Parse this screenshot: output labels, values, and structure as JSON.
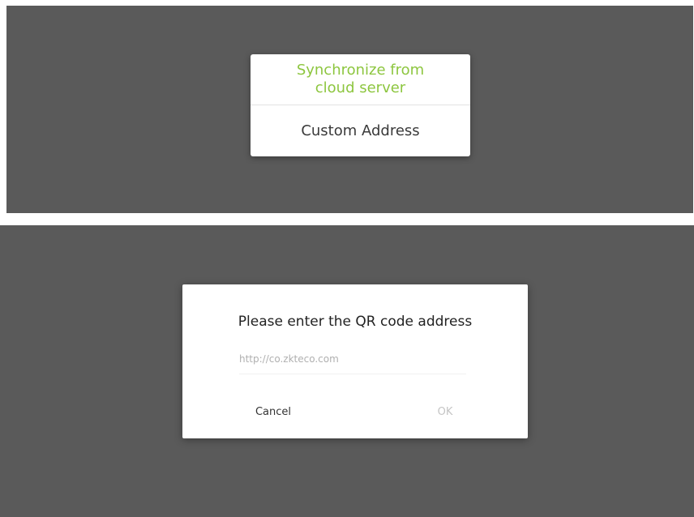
{
  "sync_menu": {
    "options": [
      {
        "label": "Synchronize from\ncloud server",
        "color": "#8dc63f"
      },
      {
        "label": "Custom Address",
        "color": "#3a3a3a"
      }
    ]
  },
  "qr_dialog": {
    "title": "Please enter the QR code address",
    "address_value": "http://co.zkteco.com",
    "cancel_label": "Cancel",
    "ok_label": "OK"
  },
  "colors": {
    "backdrop": "#5a5a5a",
    "accent": "#8dc63f"
  }
}
